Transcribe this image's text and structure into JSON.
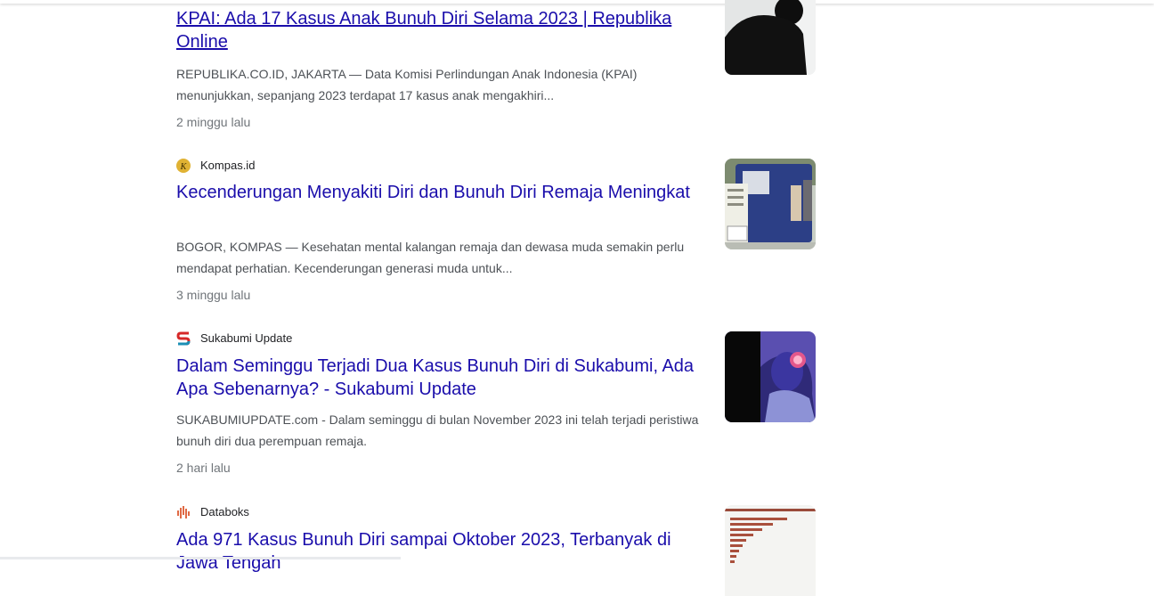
{
  "results": [
    {
      "title": "KPAI: Ada 17 Kasus Anak Bunuh Diri Selama 2023 | Republika Online",
      "snippet": "REPUBLIKA.CO.ID, JAKARTA — Data Komisi Perlindungan Anak Indonesia (KPAI) menunjukkan, sepanjang 2023 terdapat 17 kasus anak mengakhiri...",
      "time": "2 minggu lalu",
      "thumbnail_icon": "silhouette-photo"
    },
    {
      "source": "Kompas.id",
      "favicon_icon": "kompas-icon",
      "title": "Kecenderungan Menyakiti Diri dan Bunuh Diri Remaja Meningkat",
      "snippet": "BOGOR, KOMPAS — Kesehatan mental kalangan remaja dan dewasa muda semakin perlu mendapat perhatian. Kecenderungan generasi muda untuk...",
      "time": "3 minggu lalu",
      "thumbnail_icon": "van-photo"
    },
    {
      "source": "Sukabumi Update",
      "favicon_icon": "sukabumi-update-icon",
      "title": "Dalam Seminggu Terjadi Dua Kasus Bunuh Diri di Sukabumi, Ada Apa Sebenarnya? - Sukabumi Update",
      "snippet": "SUKABUMIUPDATE.com - Dalam seminggu di bulan November 2023 ini telah terjadi peristiwa bunuh diri dua perempuan remaja.",
      "time": "2 hari lalu",
      "thumbnail_icon": "mental-health-illustration"
    },
    {
      "source": "Databoks",
      "favicon_icon": "databoks-icon",
      "title": "Ada 971 Kasus Bunuh Diri sampai Oktober 2023, Terbanyak di Jawa Tengah",
      "thumbnail_icon": "bar-chart-thumbnail"
    }
  ],
  "colors": {
    "title": "#1a0dab",
    "snippet": "#4d5156",
    "time": "#70757a",
    "source": "#202124"
  }
}
